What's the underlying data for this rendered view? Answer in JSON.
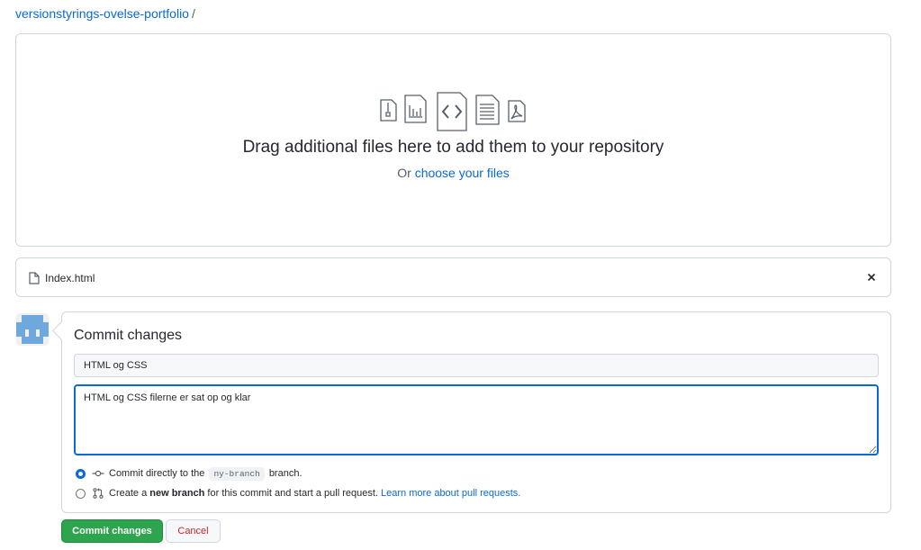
{
  "breadcrumb": {
    "repo": "versionstyrings-ovelse-portfolio",
    "separator": "/"
  },
  "dropzone": {
    "icons": [
      "zip-file-icon",
      "chart-file-icon",
      "code-file-icon",
      "text-file-icon",
      "pdf-file-icon"
    ],
    "title": "Drag additional files here to add them to your repository",
    "sub_prefix": "Or ",
    "sub_link": "choose your files"
  },
  "file": {
    "name": "Index.html",
    "remove_icon": "close-icon"
  },
  "commit": {
    "title": "Commit changes",
    "summary_value": "HTML og CSS",
    "description_value": "HTML og CSS filerne er sat op og klar",
    "option_direct": {
      "prefix": "Commit directly to the",
      "branch": "ny-branch",
      "suffix": "branch.",
      "icon": "git-commit-icon",
      "selected": true
    },
    "option_new_branch": {
      "prefix": "Create a ",
      "bold": "new branch",
      "middle": " for this commit and start a pull request. ",
      "link": "Learn more about pull requests.",
      "icon": "git-pull-request-icon",
      "selected": false
    },
    "submit_label": "Commit changes",
    "cancel_label": "Cancel"
  },
  "colors": {
    "link": "#0969da",
    "submit": "#2da44e",
    "cancel_text": "#cf222e",
    "avatar": "#6fa8dc"
  }
}
